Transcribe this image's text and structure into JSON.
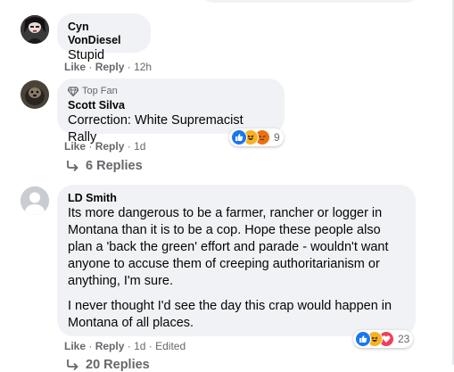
{
  "comments": [
    {
      "author": "Cyn VonDiesel",
      "text": "Stupid",
      "like": "Like",
      "reply": "Reply",
      "time": "12h"
    },
    {
      "badge": "Top Fan",
      "author": "Scott Silva",
      "text": "Correction: White Supremacist Rally",
      "like": "Like",
      "reply": "Reply",
      "time": "1d",
      "reaction_count": "9",
      "replies_label": "6 Replies"
    },
    {
      "author": "LD Smith",
      "text_p1": "Its more dangerous to be a farmer, rancher or logger in Montana than it is to be a cop. Hope these people also plan a 'back the green' effort and parade - wouldn't want anyone to accuse them of creeping authoritarianism or anything, I'm sure.",
      "text_p2": "I never thought I'd see the day this crap would happen in Montana of all places.",
      "like": "Like",
      "reply": "Reply",
      "time": "1d",
      "edited": "Edited",
      "reaction_count": "23",
      "replies_label": "20 Replies"
    }
  ],
  "colors": {
    "bubble": "#f0f2f5",
    "secondary_text": "#65676b",
    "like_blue": "#1877f2",
    "love_red": "#f33e58",
    "haha_yellow": "#f7b125"
  },
  "icons": {
    "top_fan": "diamond-icon",
    "replies": "reply-arrow-icon",
    "reactions": [
      "like-icon",
      "haha-icon",
      "angry-icon",
      "love-icon"
    ]
  }
}
